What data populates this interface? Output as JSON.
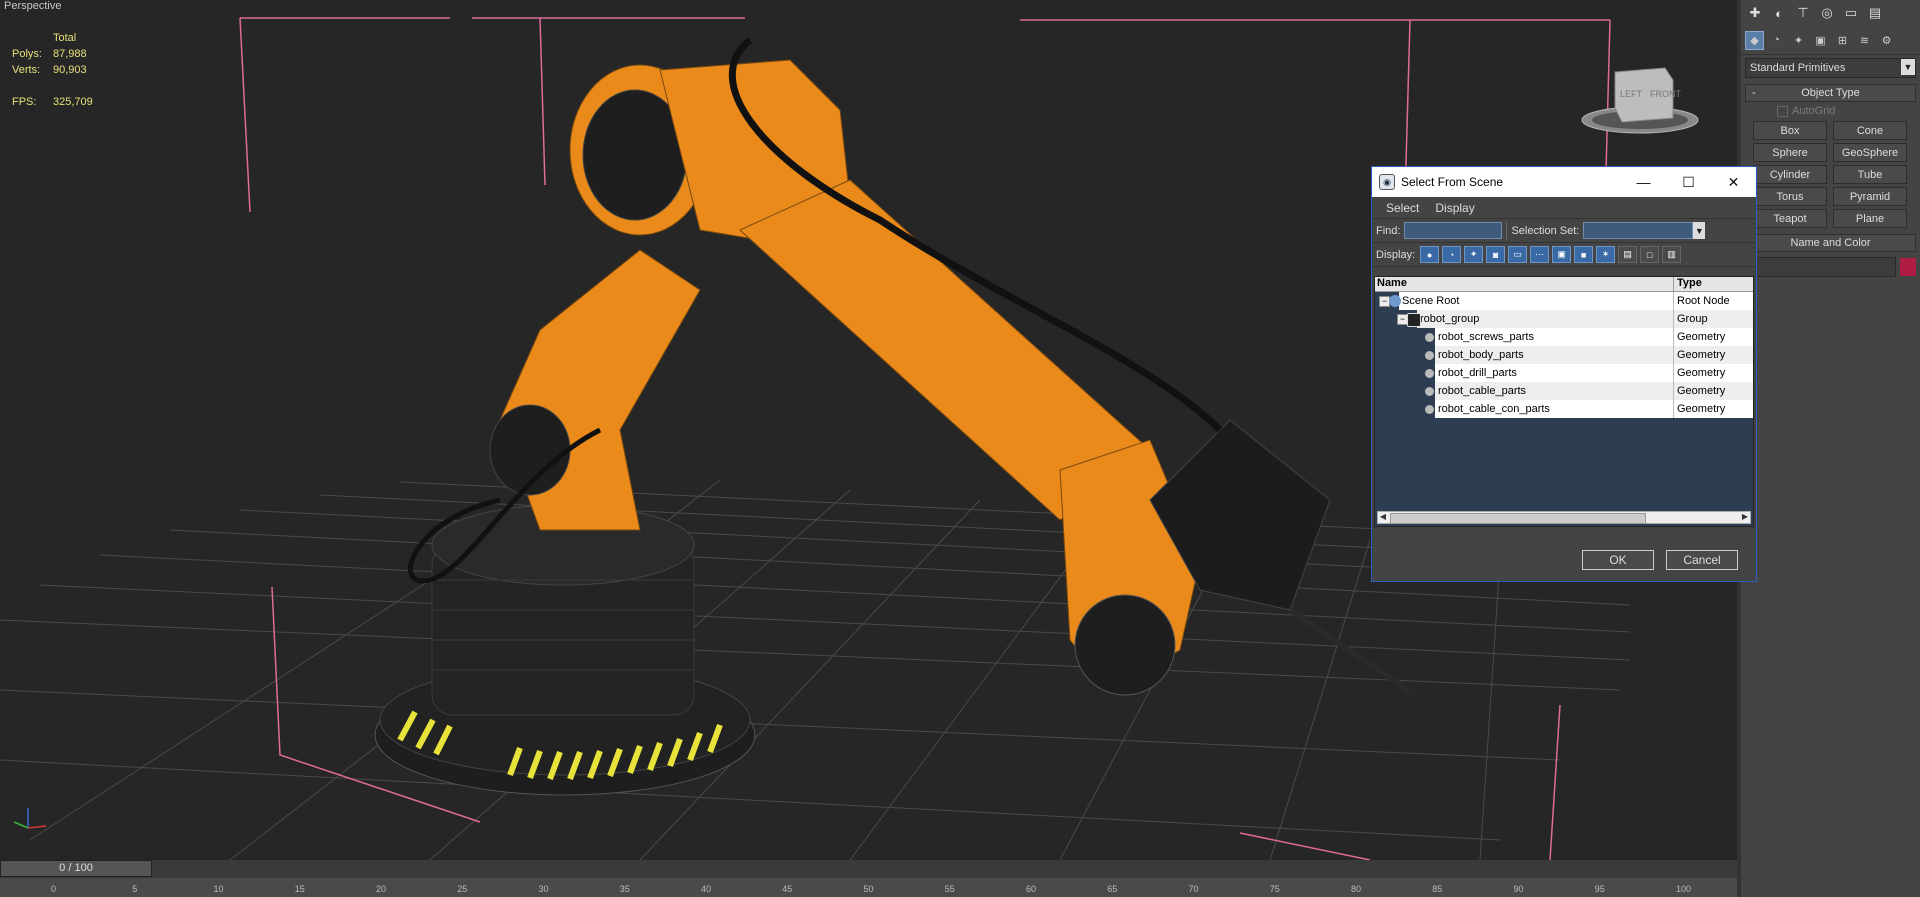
{
  "viewport": {
    "label": "Perspective",
    "stats": {
      "header": "Total",
      "polys_label": "Polys:",
      "polys_value": "87,988",
      "verts_label": "Verts:",
      "verts_value": "90,903",
      "fps_label": "FPS:",
      "fps_value": "325,709"
    },
    "navcube": {
      "left": "LEFT",
      "front": "FRONT"
    }
  },
  "timeline": {
    "frame": "0 / 100",
    "ticks": [
      "0",
      "5",
      "10",
      "15",
      "20",
      "25",
      "30",
      "35",
      "40",
      "45",
      "50",
      "55",
      "60",
      "65",
      "70",
      "75",
      "80",
      "85",
      "90",
      "95",
      "100"
    ]
  },
  "panel": {
    "tab_icons": [
      "create-icon",
      "modify-icon",
      "hierarchy-icon",
      "motion-icon",
      "display-icon",
      "utilities-icon"
    ],
    "sub_icons": [
      "geometry-icon",
      "shapes-icon",
      "lights-icon",
      "cameras-icon",
      "helpers-icon",
      "spacewarps-icon",
      "systems-icon"
    ],
    "category": "Standard Primitives",
    "object_type": {
      "title": "Object Type",
      "autogrid": "AutoGrid",
      "buttons": [
        "Box",
        "Cone",
        "Sphere",
        "GeoSphere",
        "Cylinder",
        "Tube",
        "Torus",
        "Pyramid",
        "Teapot",
        "Plane"
      ]
    },
    "name_and_color": {
      "title": "Name and Color",
      "color": "#b01d44"
    }
  },
  "dialog": {
    "title": "Select From Scene",
    "menu": [
      "Select",
      "Display"
    ],
    "find_label": "Find:",
    "selection_set_label": "Selection Set:",
    "display_label": "Display:",
    "columns": {
      "name": "Name",
      "type": "Type"
    },
    "rows": [
      {
        "name": "Scene Root",
        "type": "Root Node",
        "level": 0
      },
      {
        "name": "robot_group",
        "type": "Group",
        "level": 1
      },
      {
        "name": "robot_screws_parts",
        "type": "Geometry",
        "level": 2
      },
      {
        "name": "robot_body_parts",
        "type": "Geometry",
        "level": 2
      },
      {
        "name": "robot_drill_parts",
        "type": "Geometry",
        "level": 2
      },
      {
        "name": "robot_cable_parts",
        "type": "Geometry",
        "level": 2
      },
      {
        "name": "robot_cable_con_parts",
        "type": "Geometry",
        "level": 2
      }
    ],
    "ok": "OK",
    "cancel": "Cancel"
  }
}
